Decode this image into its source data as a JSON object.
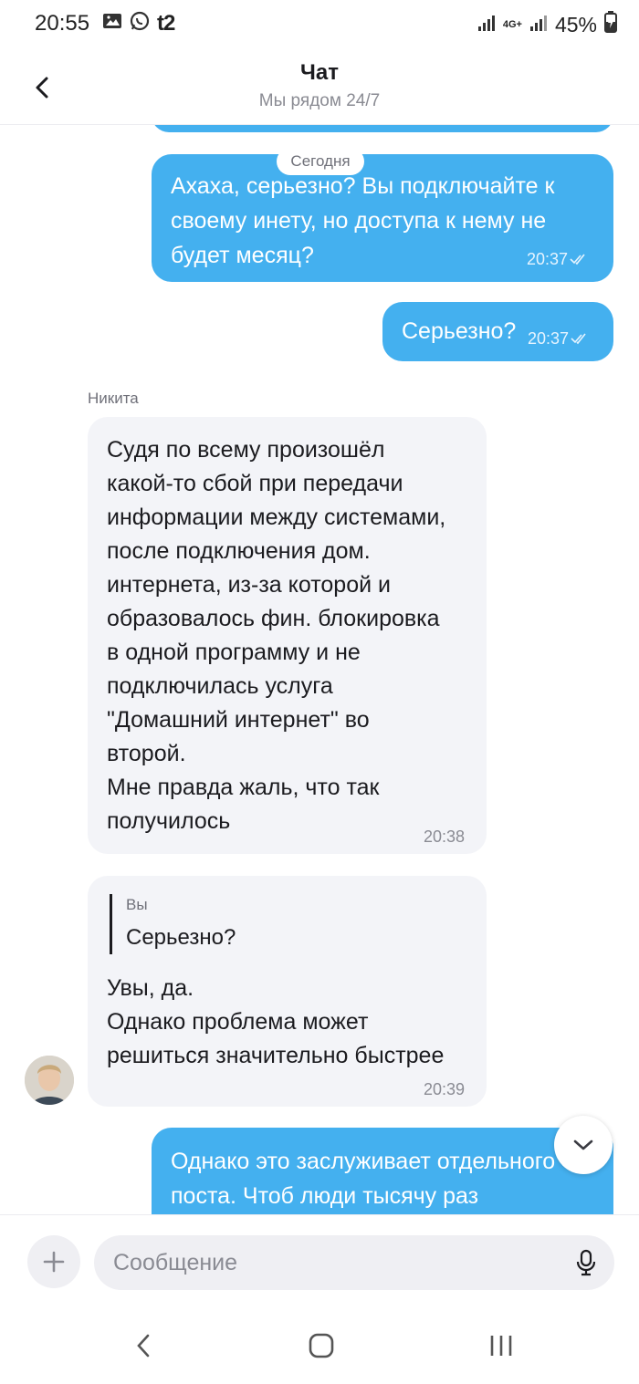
{
  "status_bar": {
    "time": "20:55",
    "carrier": "t2",
    "network": "4G+",
    "battery": "45%"
  },
  "header": {
    "title": "Чат",
    "subtitle": "Мы рядом 24/7"
  },
  "chat": {
    "date_separator": "Сегодня",
    "messages": [
      {
        "direction": "out",
        "lines": [
          "Ахаха, серьезно? Вы подключайте к",
          "своему инету, но доступа к нему не",
          "будет месяц?"
        ],
        "time": "20:37",
        "status": "read"
      },
      {
        "direction": "out",
        "lines": [
          "Серьезно?"
        ],
        "time": "20:37",
        "status": "read"
      },
      {
        "direction": "in",
        "sender": "Никита",
        "lines": [
          "Судя по всему произошёл",
          "какой-то сбой при передачи",
          "информации между системами,",
          "после подключения дом.",
          "интернета, из-за которой и",
          "образовалось фин. блокировка",
          "в одной программу и не",
          "подключилась услуга",
          "\"Домашний интернет\" во",
          "второй.",
          "Мне правда жаль, что так",
          "получилось"
        ],
        "time": "20:38"
      },
      {
        "direction": "in",
        "reply_to": {
          "author": "Вы",
          "text": "Серьезно?"
        },
        "lines": [
          "Увы, да.",
          "Однако проблема может",
          "решиться значительно быстрее"
        ],
        "time": "20:39"
      },
      {
        "direction": "out",
        "lines": [
          "Однако это заслуживает отдельного",
          "поста. Чтоб люди тысячу раз"
        ]
      }
    ]
  },
  "composer": {
    "placeholder": "Сообщение"
  },
  "colors": {
    "outgoing_bubble": "#44b0ef",
    "incoming_bubble": "#f3f4f8"
  }
}
